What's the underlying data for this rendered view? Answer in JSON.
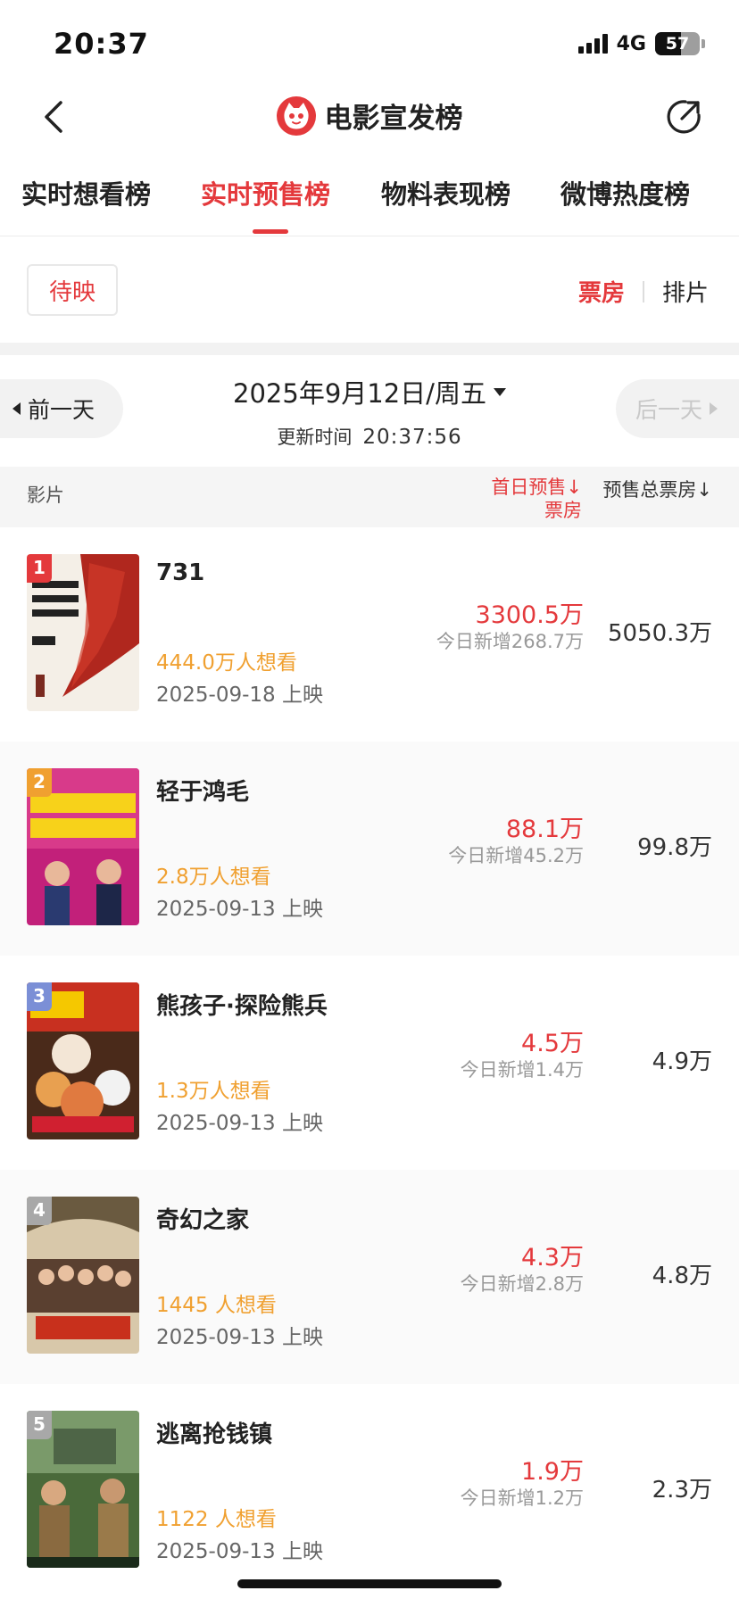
{
  "status_bar": {
    "time": "20:37",
    "network": "4G",
    "battery": "57",
    "battery_level": 0.57
  },
  "nav": {
    "title": "电影宣发榜"
  },
  "tabs": [
    {
      "label": "实时想看榜",
      "active": false
    },
    {
      "label": "实时预售榜",
      "active": true
    },
    {
      "label": "物料表现榜",
      "active": false
    },
    {
      "label": "微博热度榜",
      "active": false
    }
  ],
  "filter": {
    "chip": "待映",
    "toggle": [
      "票房",
      "排片"
    ],
    "active_toggle": "票房"
  },
  "date_bar": {
    "prev": "前一天",
    "next": "后一天",
    "date": "2025年9月12日/周五",
    "update_label": "更新时间",
    "update_time": "20:37:56"
  },
  "table_header": {
    "film": "影片",
    "first_day_line1": "首日预售↓",
    "first_day_line2": "票房",
    "total": "预售总票房↓"
  },
  "movies": [
    {
      "rank": "1",
      "title": "731",
      "want": "444.0万人想看",
      "release": "2025-09-18 上映",
      "first_day": "3300.5万",
      "today_add": "今日新增268.7万",
      "total": "5050.3万",
      "badge_color": "#e4393c"
    },
    {
      "rank": "2",
      "title": "轻于鸿毛",
      "want": "2.8万人想看",
      "release": "2025-09-13 上映",
      "first_day": "88.1万",
      "today_add": "今日新增45.2万",
      "total": "99.8万",
      "badge_color": "#f0a030"
    },
    {
      "rank": "3",
      "title": "熊孩子·探险熊兵",
      "want": "1.3万人想看",
      "release": "2025-09-13 上映",
      "first_day": "4.5万",
      "today_add": "今日新增1.4万",
      "total": "4.9万",
      "badge_color": "#7b8fd6"
    },
    {
      "rank": "4",
      "title": "奇幻之家",
      "want": "1445 人想看",
      "release": "2025-09-13 上映",
      "first_day": "4.3万",
      "today_add": "今日新增2.8万",
      "total": "4.8万",
      "badge_color": "#a8a8a8"
    },
    {
      "rank": "5",
      "title": "逃离抢钱镇",
      "want": "1122 人想看",
      "release": "2025-09-13 上映",
      "first_day": "1.9万",
      "today_add": "今日新增1.2万",
      "total": "2.3万",
      "badge_color": "#a8a8a8"
    }
  ],
  "colors": {
    "accent": "#e4393c",
    "want": "#f0a030"
  }
}
